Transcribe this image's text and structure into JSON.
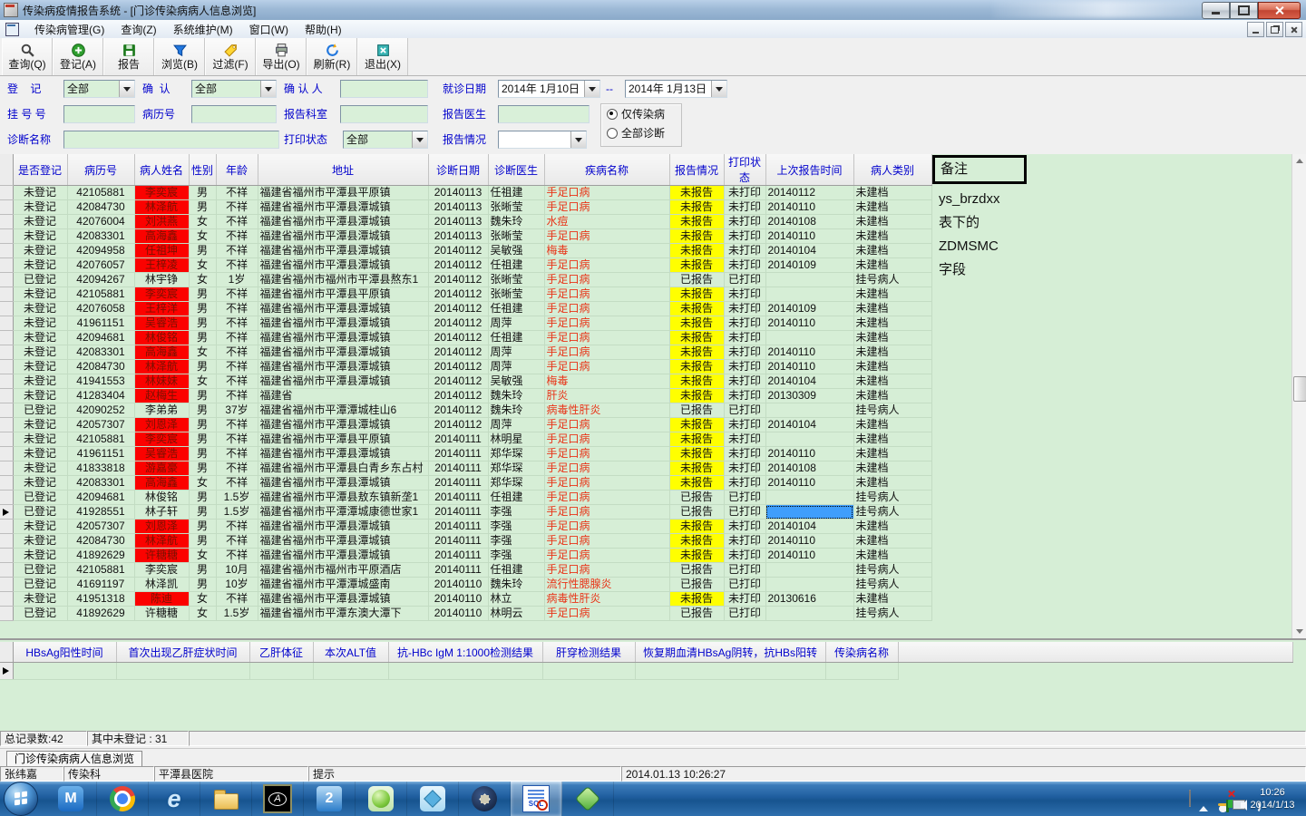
{
  "window": {
    "title": "传染病疫情报告系统 - [门诊传染病病人信息浏览]",
    "caption_buttons": [
      "minimize",
      "maximize",
      "close"
    ]
  },
  "menu_bar": {
    "items": [
      "传染病管理(G)",
      "查询(Z)",
      "系统维护(M)",
      "窗口(W)",
      "帮助(H)"
    ]
  },
  "toolbar": {
    "buttons": [
      {
        "label": "查询(Q)",
        "icon": "search-icon"
      },
      {
        "label": "登记(A)",
        "icon": "register-icon"
      },
      {
        "label": "报告",
        "icon": "report-icon"
      },
      {
        "label": "浏览(B)",
        "icon": "browse-icon"
      },
      {
        "label": "过滤(F)",
        "icon": "filter-icon"
      },
      {
        "label": "导出(O)",
        "icon": "export-icon"
      },
      {
        "label": "刷新(R)",
        "icon": "refresh-icon"
      },
      {
        "label": "退出(X)",
        "icon": "exit-icon"
      }
    ]
  },
  "filters": {
    "register_label": "登    记",
    "register_value": "全部",
    "confirm_label": "确  认",
    "confirm_value": "全部",
    "confirmer_label": "确 认 人",
    "confirmer_value": "",
    "visit_date_label": "就诊日期",
    "visit_date_from": "2014年 1月10日",
    "visit_date_sep": "--",
    "visit_date_to": "2014年 1月13日",
    "regno_label": "挂 号 号",
    "regno_value": "",
    "caseno_label": "病历号",
    "caseno_value": "",
    "dept_label": "报告科室",
    "dept_value": "",
    "doctor_label": "报告医生",
    "doctor_value": "",
    "scope_options": [
      "仅传染病",
      "全部诊断"
    ],
    "scope_selected": "仅传染病",
    "diagnosis_label": "诊断名称",
    "diagnosis_value": "",
    "print_label": "打印状态",
    "print_value": "全部",
    "report_label": "报告情况",
    "report_value": ""
  },
  "grid": {
    "headers": [
      "是否登记",
      "病历号",
      "病人姓名",
      "性别",
      "年龄",
      "地址",
      "诊断日期",
      "诊断医生",
      "疾病名称",
      "报告情况",
      "打印状态",
      "上次报告时间",
      "病人类别"
    ],
    "col_keys": [
      "registered",
      "case-no",
      "patient-name",
      "sex",
      "age",
      "address",
      "diagnosis-date",
      "diagnosis-doctor",
      "disease-name",
      "report-status",
      "print-status",
      "last-report-time",
      "patient-category"
    ],
    "annotation": {
      "box_label": "备注",
      "lines": [
        "ys_brzdxx",
        "表下的",
        "ZDMSMC",
        "字段"
      ]
    },
    "current_row": 23,
    "selected_col": 11,
    "rows": [
      [
        "未登记",
        "42105881",
        "李奕宸",
        "男",
        "不祥",
        "福建省福州市平潭县平原镇",
        "20140113",
        "任祖建",
        "手足口病",
        "未报告",
        "未打印",
        "20140112",
        "未建档",
        1
      ],
      [
        "未登记",
        "42084730",
        "林泽航",
        "男",
        "不祥",
        "福建省福州市平潭县潭城镇",
        "20140113",
        "张晰莹",
        "手足口病",
        "未报告",
        "未打印",
        "20140110",
        "未建档",
        1
      ],
      [
        "未登记",
        "42076004",
        "刘洪燕",
        "女",
        "不祥",
        "福建省福州市平潭县潭城镇",
        "20140113",
        "魏朱玲",
        "水痘",
        "未报告",
        "未打印",
        "20140108",
        "未建档",
        1
      ],
      [
        "未登记",
        "42083301",
        "高海鑫",
        "女",
        "不祥",
        "福建省福州市平潭县潭城镇",
        "20140113",
        "张晰莹",
        "手足口病",
        "未报告",
        "未打印",
        "20140110",
        "未建档",
        1
      ],
      [
        "未登记",
        "42094958",
        "任祖坤",
        "男",
        "不祥",
        "福建省福州市平潭县潭城镇",
        "20140112",
        "吴敏强",
        "梅毒",
        "未报告",
        "未打印",
        "20140104",
        "未建档",
        1
      ],
      [
        "未登记",
        "42076057",
        "王梓凌",
        "女",
        "不祥",
        "福建省福州市平潭县潭城镇",
        "20140112",
        "任祖建",
        "手足口病",
        "未报告",
        "未打印",
        "20140109",
        "未建档",
        1
      ],
      [
        "已登记",
        "42094267",
        "林宇铮",
        "女",
        "1岁",
        "福建省福州市福州市平潭县熬东1",
        "20140112",
        "张晰莹",
        "手足口病",
        "已报告",
        "已打印",
        "",
        "挂号病人",
        0
      ],
      [
        "未登记",
        "42105881",
        "李奕宸",
        "男",
        "不祥",
        "福建省福州市平潭县平原镇",
        "20140112",
        "张晰莹",
        "手足口病",
        "未报告",
        "未打印",
        "",
        "未建档",
        1
      ],
      [
        "未登记",
        "42076058",
        "王梓洋",
        "男",
        "不祥",
        "福建省福州市平潭县潭城镇",
        "20140112",
        "任祖建",
        "手足口病",
        "未报告",
        "未打印",
        "20140109",
        "未建档",
        1
      ],
      [
        "未登记",
        "41961151",
        "吴睿浩",
        "男",
        "不祥",
        "福建省福州市平潭县潭城镇",
        "20140112",
        "周萍",
        "手足口病",
        "未报告",
        "未打印",
        "20140110",
        "未建档",
        1
      ],
      [
        "未登记",
        "42094681",
        "林俊铭",
        "男",
        "不祥",
        "福建省福州市平潭县潭城镇",
        "20140112",
        "任祖建",
        "手足口病",
        "未报告",
        "未打印",
        "",
        "未建档",
        1
      ],
      [
        "未登记",
        "42083301",
        "高海鑫",
        "女",
        "不祥",
        "福建省福州市平潭县潭城镇",
        "20140112",
        "周萍",
        "手足口病",
        "未报告",
        "未打印",
        "20140110",
        "未建档",
        1
      ],
      [
        "未登记",
        "42084730",
        "林泽航",
        "男",
        "不祥",
        "福建省福州市平潭县潭城镇",
        "20140112",
        "周萍",
        "手足口病",
        "未报告",
        "未打印",
        "20140110",
        "未建档",
        1
      ],
      [
        "未登记",
        "41941553",
        "林妹妹",
        "女",
        "不祥",
        "福建省福州市平潭县潭城镇",
        "20140112",
        "吴敏强",
        "梅毒",
        "未报告",
        "未打印",
        "20140104",
        "未建档",
        1
      ],
      [
        "未登记",
        "41283404",
        "赵梅生",
        "男",
        "不祥",
        "福建省",
        "20140112",
        "魏朱玲",
        "肝炎",
        "未报告",
        "未打印",
        "20130309",
        "未建档",
        1
      ],
      [
        "已登记",
        "42090252",
        "李弟弟",
        "男",
        "37岁",
        "福建省福州市平潭潭城桂山6",
        "20140112",
        "魏朱玲",
        "病毒性肝炎",
        "已报告",
        "已打印",
        "",
        "挂号病人",
        0
      ],
      [
        "未登记",
        "42057307",
        "刘恩泽",
        "男",
        "不祥",
        "福建省福州市平潭县潭城镇",
        "20140112",
        "周萍",
        "手足口病",
        "未报告",
        "未打印",
        "20140104",
        "未建档",
        1
      ],
      [
        "未登记",
        "42105881",
        "李奕宸",
        "男",
        "不祥",
        "福建省福州市平潭县平原镇",
        "20140111",
        "林明星",
        "手足口病",
        "未报告",
        "未打印",
        "",
        "未建档",
        1
      ],
      [
        "未登记",
        "41961151",
        "吴睿浩",
        "男",
        "不祥",
        "福建省福州市平潭县潭城镇",
        "20140111",
        "郑华琛",
        "手足口病",
        "未报告",
        "未打印",
        "20140110",
        "未建档",
        1
      ],
      [
        "未登记",
        "41833818",
        "游嘉豪",
        "男",
        "不祥",
        "福建省福州市平潭县白青乡东占村",
        "20140111",
        "郑华琛",
        "手足口病",
        "未报告",
        "未打印",
        "20140108",
        "未建档",
        1
      ],
      [
        "未登记",
        "42083301",
        "高海鑫",
        "女",
        "不祥",
        "福建省福州市平潭县潭城镇",
        "20140111",
        "郑华琛",
        "手足口病",
        "未报告",
        "未打印",
        "20140110",
        "未建档",
        1
      ],
      [
        "已登记",
        "42094681",
        "林俊铭",
        "男",
        "1.5岁",
        "福建省福州市平潭县敖东镇新垄1",
        "20140111",
        "任祖建",
        "手足口病",
        "已报告",
        "已打印",
        "",
        "挂号病人",
        0
      ],
      [
        "已登记",
        "41928551",
        "林子轩",
        "男",
        "1.5岁",
        "福建省福州市平潭潭城康德世家1",
        "20140111",
        "李强",
        "手足口病",
        "已报告",
        "已打印",
        "",
        "挂号病人",
        0
      ],
      [
        "未登记",
        "42057307",
        "刘恩泽",
        "男",
        "不祥",
        "福建省福州市平潭县潭城镇",
        "20140111",
        "李强",
        "手足口病",
        "未报告",
        "未打印",
        "20140104",
        "未建档",
        1
      ],
      [
        "未登记",
        "42084730",
        "林泽航",
        "男",
        "不祥",
        "福建省福州市平潭县潭城镇",
        "20140111",
        "李强",
        "手足口病",
        "未报告",
        "未打印",
        "20140110",
        "未建档",
        1
      ],
      [
        "未登记",
        "41892629",
        "许糖糖",
        "女",
        "不祥",
        "福建省福州市平潭县潭城镇",
        "20140111",
        "李强",
        "手足口病",
        "未报告",
        "未打印",
        "20140110",
        "未建档",
        1
      ],
      [
        "已登记",
        "42105881",
        "李奕宸",
        "男",
        "10月",
        "福建省福州市福州市平原酒店",
        "20140111",
        "任祖建",
        "手足口病",
        "已报告",
        "已打印",
        "",
        "挂号病人",
        0
      ],
      [
        "已登记",
        "41691197",
        "林泽凯",
        "男",
        "10岁",
        "福建省福州市平潭潭城盛南",
        "20140110",
        "魏朱玲",
        "流行性腮腺炎",
        "已报告",
        "已打印",
        "",
        "挂号病人",
        0
      ],
      [
        "未登记",
        "41951318",
        "陈迪",
        "女",
        "不祥",
        "福建省福州市平潭县潭城镇",
        "20140110",
        "林立",
        "病毒性肝炎",
        "未报告",
        "未打印",
        "20130616",
        "未建档",
        1
      ],
      [
        "已登记",
        "41892629",
        "许糖糖",
        "女",
        "1.5岁",
        "福建省福州市平潭东澳大潭下",
        "20140110",
        "林明云",
        "手足口病",
        "已报告",
        "已打印",
        "",
        "挂号病人",
        0
      ]
    ]
  },
  "bottom_grid": {
    "headers": [
      "HBsAg阳性时间",
      "首次出现乙肝症状时间",
      "乙肝体征",
      "本次ALT值",
      "抗-HBc IgM 1:1000检测结果",
      "肝穿检测结果",
      "恢复期血清HBsAg阴转，抗HBs阳转",
      "传染病名称"
    ]
  },
  "records_bar": {
    "total": "总记录数:42",
    "unregistered": "其中未登记 : 31"
  },
  "doc_tab": "门诊传染病病人信息浏览",
  "status_bar": {
    "user": "张纬嘉",
    "dept": "传染科",
    "hospital": "平潭县医院",
    "hint": "提示",
    "datetime": "2014.01.13 10:26:27"
  },
  "taskbar": {
    "apps": [
      {
        "name": "maxthon",
        "active": false
      },
      {
        "name": "chrome",
        "active": false
      },
      {
        "name": "ie",
        "active": false
      },
      {
        "name": "explorer",
        "active": false
      },
      {
        "name": "action",
        "active": false
      },
      {
        "name": "app2",
        "active": false
      },
      {
        "name": "green-sphere",
        "active": false
      },
      {
        "name": "cube",
        "active": false
      },
      {
        "name": "compass",
        "active": false
      },
      {
        "name": "sql",
        "active": true
      },
      {
        "name": "gem",
        "active": false
      }
    ],
    "tray": [
      "keyboard",
      "hidden-icons",
      "qq",
      "safety-flag",
      "network",
      "volume"
    ],
    "clock": {
      "time": "10:26",
      "date": "2014/1/13"
    }
  },
  "colors": {
    "label_blue": "#0000cc",
    "grid_green": "#d6eed6",
    "name_highlight_red": "#fb0200",
    "disease_red": "#e83418",
    "unreported_yellow": "#ffff00",
    "selected_cell_blue": "#3f9efc",
    "taskbar_blue": "#1f5d9e"
  }
}
